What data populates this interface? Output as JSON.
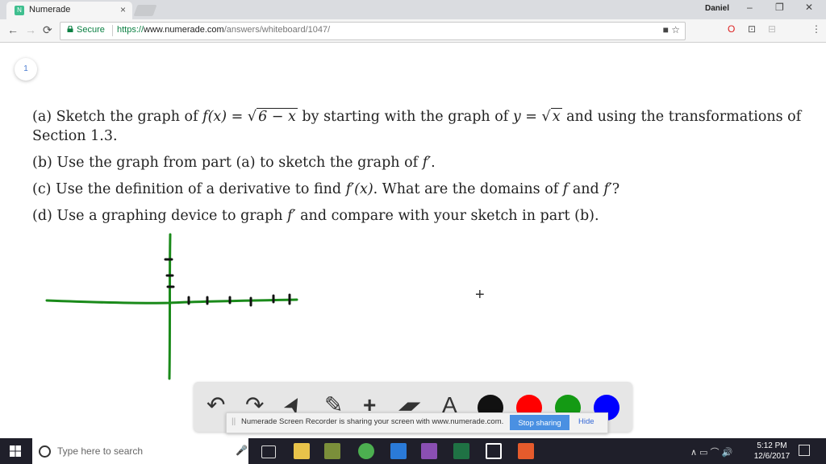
{
  "browser": {
    "tab_title": "Numerade",
    "tab_favicon": "N",
    "tab_close": "×",
    "user_badge": "Daniel",
    "window_controls": [
      "–",
      "❐",
      "✕"
    ],
    "nav_back": "←",
    "nav_forward": "→",
    "nav_reload": "⟳",
    "secure_label": "Secure",
    "url_scheme": "https://",
    "url_host": "www.numerade.com",
    "url_path": "/answers/whiteboard/1047/",
    "omnibox_icons": "■ ☆",
    "extension_icons": [
      "O",
      "⊡",
      "⊟",
      "⋮"
    ]
  },
  "page": {
    "badge_number": "1",
    "problem": {
      "a_prefix": "(a) Sketch the graph of ",
      "a_fx": "f(x) = ",
      "a_sqrt1": "6 − x",
      "a_mid": " by starting with the graph of ",
      "a_y": "y = ",
      "a_sqrt2": "x",
      "a_suffix": " and using the transformations of Section 1.3.",
      "b_prefix": "(b) Use the graph from part (a) to sketch the graph of ",
      "b_fprime": "f′",
      "b_suffix": ".",
      "c_prefix": "(c) Use the definition of a derivative to find ",
      "c_fprimex": "f′(x)",
      "c_mid": ". What are the domains of ",
      "c_f": "f",
      "c_and": " and ",
      "c_fprime": "f′",
      "c_suffix": "?",
      "d_prefix": "(d) Use a graphing device to graph ",
      "d_fprime": "f′",
      "d_suffix": " and compare with your sketch in part (b)."
    },
    "crosshair": "+",
    "sketch_color": "#1a8a1a"
  },
  "drawing_toolbar": {
    "tools": [
      "undo-icon",
      "redo-icon",
      "pointer-icon",
      "pen-icon",
      "plus-icon",
      "eraser-icon",
      "text-icon"
    ],
    "tool_glyphs": [
      "↶",
      "↷",
      "➤",
      "✎",
      "+",
      "▰",
      "A"
    ],
    "colors": [
      "#111111",
      "#ff0000",
      "#149a14",
      "#0000ff"
    ]
  },
  "share_banner": {
    "grip": "||",
    "message": "Numerade Screen Recorder is sharing your screen with www.numerade.com.",
    "stop_label": "Stop sharing",
    "hide_label": "Hide"
  },
  "taskbar": {
    "search_placeholder": "Type here to search",
    "mic_glyph": "🎤",
    "tray_glyphs": "∧ ▭ ⌒ 🔊",
    "time": "5:12 PM",
    "date": "12/6/2017",
    "app_colors": [
      "#e8c34a",
      "#7b8f3a",
      "#4caf50",
      "#2a7ad8",
      "#8a4fb3",
      "#1f7244",
      "#ffffff",
      "#e55b2c"
    ]
  }
}
